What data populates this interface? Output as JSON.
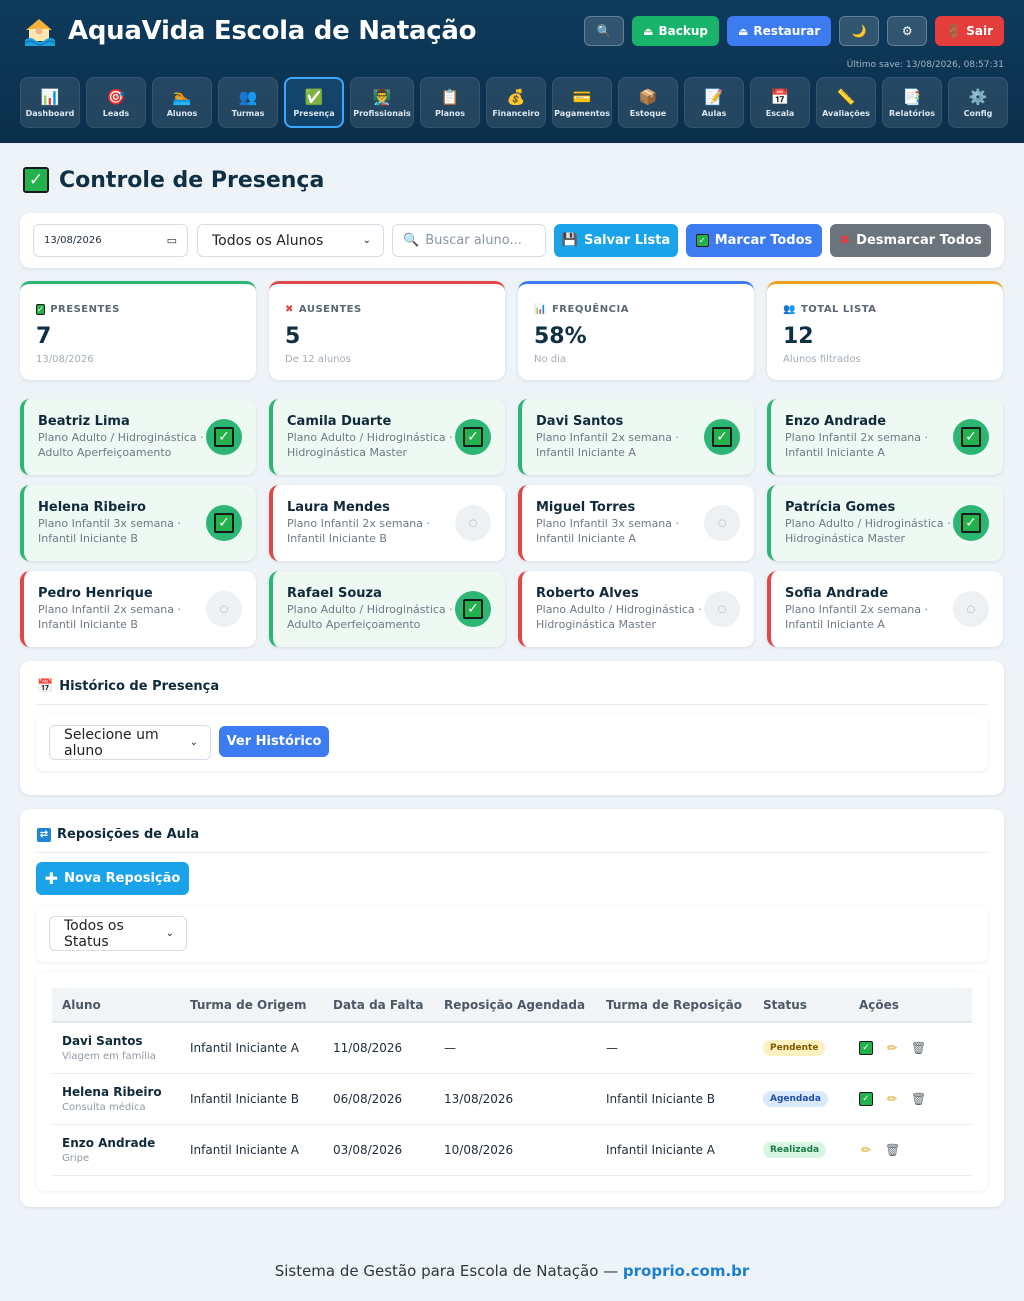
{
  "app": {
    "title": "AquaVida Escola de Natação",
    "last_save": "Último save: 13/08/2026, 08:57:31"
  },
  "top_actions": {
    "backup": "Backup",
    "restore": "Restaurar",
    "logout": "Sair"
  },
  "nav": [
    {
      "label": "Dashboard",
      "icon": "📊"
    },
    {
      "label": "Leads",
      "icon": "🎯"
    },
    {
      "label": "Alunos",
      "icon": "🏊"
    },
    {
      "label": "Turmas",
      "icon": "👥"
    },
    {
      "label": "Presença",
      "icon": "✅",
      "active": true
    },
    {
      "label": "Profissionais",
      "icon": "👨‍🏫"
    },
    {
      "label": "Planos",
      "icon": "📋"
    },
    {
      "label": "Financeiro",
      "icon": "💰"
    },
    {
      "label": "Pagamentos",
      "icon": "💳"
    },
    {
      "label": "Estoque",
      "icon": "📦"
    },
    {
      "label": "Aulas",
      "icon": "📝"
    },
    {
      "label": "Escala",
      "icon": "📅"
    },
    {
      "label": "Avaliações",
      "icon": "📏"
    },
    {
      "label": "Relatórios",
      "icon": "📑"
    },
    {
      "label": "Config",
      "icon": "⚙️"
    }
  ],
  "page": {
    "title": "Controle de Presença"
  },
  "toolbar": {
    "date": "13/08/2026",
    "student_filter": "Todos os Alunos",
    "search_placeholder": "Buscar aluno...",
    "save_label": "Salvar Lista",
    "mark_all_label": "Marcar Todos",
    "unmark_all_label": "Desmarcar Todos"
  },
  "stats": [
    {
      "label": "PRESENTES",
      "value": "7",
      "sub": "13/08/2026",
      "color": "#2bb673",
      "icon": "check"
    },
    {
      "label": "AUSENTES",
      "value": "5",
      "sub": "De 12 alunos",
      "color": "#e04848",
      "icon": "cross"
    },
    {
      "label": "FREQUÊNCIA",
      "value": "58%",
      "sub": "No dia",
      "color": "#3d7cf0",
      "icon": "chart"
    },
    {
      "label": "TOTAL LISTA",
      "value": "12",
      "sub": "Alunos filtrados",
      "color": "#f0a020",
      "icon": "people"
    }
  ],
  "students": [
    {
      "name": "Beatriz Lima",
      "line1": "Plano Adulto / Hidroginástica ·",
      "line2": "Adulto Aperfeiçoamento",
      "present": true
    },
    {
      "name": "Camila Duarte",
      "line1": "Plano Adulto / Hidroginástica ·",
      "line2": "Hidroginástica Master",
      "present": true
    },
    {
      "name": "Davi Santos",
      "line1": "Plano Infantil 2x semana ·",
      "line2": "Infantil Iniciante A",
      "present": true
    },
    {
      "name": "Enzo Andrade",
      "line1": "Plano Infantil 2x semana ·",
      "line2": "Infantil Iniciante A",
      "present": true
    },
    {
      "name": "Helena Ribeiro",
      "line1": "Plano Infantil 3x semana ·",
      "line2": "Infantil Iniciante B",
      "present": true
    },
    {
      "name": "Laura Mendes",
      "line1": "Plano Infantil 2x semana ·",
      "line2": "Infantil Iniciante B",
      "present": false
    },
    {
      "name": "Miguel Torres",
      "line1": "Plano Infantil 3x semana ·",
      "line2": "Infantil Iniciante A",
      "present": false
    },
    {
      "name": "Patrícia Gomes",
      "line1": "Plano Adulto / Hidroginástica ·",
      "line2": "Hidroginástica Master",
      "present": true
    },
    {
      "name": "Pedro Henrique",
      "line1": "Plano Infantil 2x semana ·",
      "line2": "Infantil Iniciante B",
      "present": false
    },
    {
      "name": "Rafael Souza",
      "line1": "Plano Adulto / Hidroginástica ·",
      "line2": "Adulto Aperfeiçoamento",
      "present": true
    },
    {
      "name": "Roberto Alves",
      "line1": "Plano Adulto / Hidroginástica ·",
      "line2": "Hidroginástica Master",
      "present": false
    },
    {
      "name": "Sofia Andrade",
      "line1": "Plano Infantil 2x semana ·",
      "line2": "Infantil Iniciante A",
      "present": false
    }
  ],
  "history": {
    "title": "Histórico de Presença",
    "select_label": "Selecione um aluno",
    "button_label": "Ver Histórico"
  },
  "makeup": {
    "title": "Reposições de Aula",
    "new_button": "Nova Reposição",
    "status_filter": "Todos os Status",
    "columns": [
      "Aluno",
      "Turma de Origem",
      "Data da Falta",
      "Reposição Agendada",
      "Turma de Reposição",
      "Status",
      "Ações"
    ],
    "rows": [
      {
        "name": "Davi Santos",
        "reason": "Viagem em família",
        "origin": "Infantil Iniciante A",
        "missed": "11/08/2026",
        "scheduled": "—",
        "target": "—",
        "status": "Pendente",
        "status_key": "pendente",
        "can_confirm": true
      },
      {
        "name": "Helena Ribeiro",
        "reason": "Consulta médica",
        "origin": "Infantil Iniciante B",
        "missed": "06/08/2026",
        "scheduled": "13/08/2026",
        "target": "Infantil Iniciante B",
        "status": "Agendada",
        "status_key": "agendada",
        "can_confirm": true
      },
      {
        "name": "Enzo Andrade",
        "reason": "Gripe",
        "origin": "Infantil Iniciante A",
        "missed": "03/08/2026",
        "scheduled": "10/08/2026",
        "target": "Infantil Iniciante A",
        "status": "Realizada",
        "status_key": "realizada",
        "can_confirm": false
      }
    ]
  },
  "footer": {
    "text": "Sistema de Gestão para Escola de Natação  — ",
    "link": "proprio.com.br"
  }
}
